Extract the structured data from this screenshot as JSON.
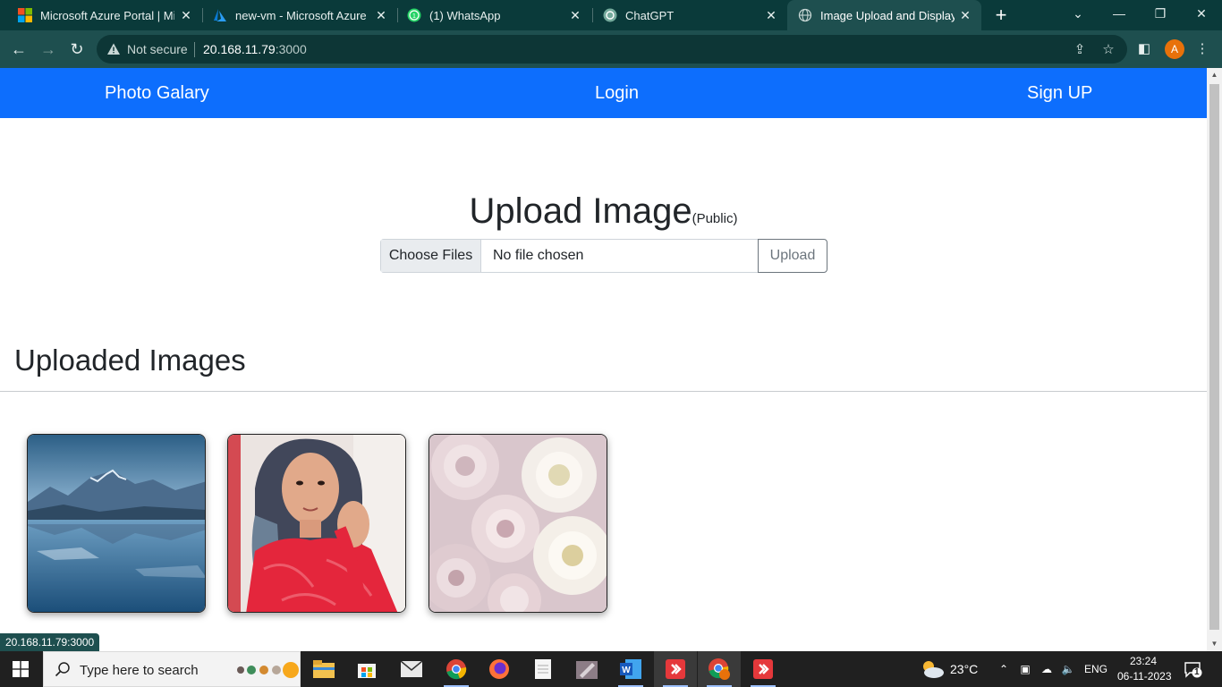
{
  "browser": {
    "tabs": [
      {
        "title": "Microsoft Azure Portal | Micr",
        "icon": "microsoft-logo-icon",
        "active": false
      },
      {
        "title": "new-vm - Microsoft Azure",
        "icon": "azure-logo-icon",
        "active": false
      },
      {
        "title": "(1) WhatsApp",
        "icon": "whatsapp-logo-icon",
        "active": false
      },
      {
        "title": "ChatGPT",
        "icon": "chatgpt-logo-icon",
        "active": false
      },
      {
        "title": "Image Upload and Display",
        "icon": "globe-icon",
        "active": true
      }
    ],
    "close_glyph": "✕",
    "new_tab_glyph": "+",
    "security_label": "Not secure",
    "url_host": "20.168.11.79",
    "url_port": ":3000",
    "profile_initial": "A",
    "status_url": "20.168.11.79:3000"
  },
  "navbar": {
    "brand": "Photo Galary",
    "login": "Login",
    "signup": "Sign UP",
    "background": "#0d6efd"
  },
  "upload": {
    "title": "Upload Image",
    "badge": "(Public)",
    "choose_label": "Choose Files",
    "no_file_label": "No file chosen",
    "upload_label": "Upload"
  },
  "gallery": {
    "title": "Uploaded Images",
    "images": [
      {
        "name": "mountain-lake-image"
      },
      {
        "name": "portrait-woman-red-dress-image"
      },
      {
        "name": "roses-bouquet-image"
      }
    ]
  },
  "taskbar": {
    "search_placeholder": "Type here to search",
    "weather": "23°C",
    "language": "ENG",
    "time": "23:24",
    "date": "06-11-2023",
    "notification_count": "1"
  }
}
